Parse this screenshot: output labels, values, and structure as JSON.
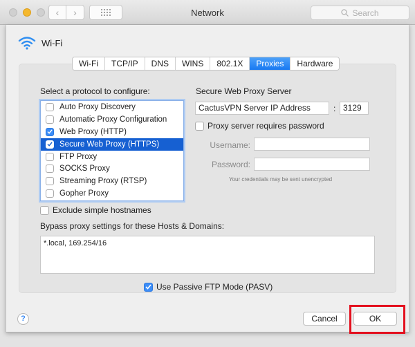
{
  "window": {
    "title": "Network",
    "search_placeholder": "Search"
  },
  "service": {
    "name": "Wi-Fi",
    "icon": "wifi-icon"
  },
  "tabs": [
    {
      "label": "Wi-Fi",
      "active": false
    },
    {
      "label": "TCP/IP",
      "active": false
    },
    {
      "label": "DNS",
      "active": false
    },
    {
      "label": "WINS",
      "active": false
    },
    {
      "label": "802.1X",
      "active": false
    },
    {
      "label": "Proxies",
      "active": true
    },
    {
      "label": "Hardware",
      "active": false
    }
  ],
  "protocols": {
    "heading": "Select a protocol to configure:",
    "items": [
      {
        "label": "Auto Proxy Discovery",
        "checked": false,
        "selected": false
      },
      {
        "label": "Automatic Proxy Configuration",
        "checked": false,
        "selected": false
      },
      {
        "label": "Web Proxy (HTTP)",
        "checked": true,
        "selected": false
      },
      {
        "label": "Secure Web Proxy (HTTPS)",
        "checked": true,
        "selected": true
      },
      {
        "label": "FTP Proxy",
        "checked": false,
        "selected": false
      },
      {
        "label": "SOCKS Proxy",
        "checked": false,
        "selected": false
      },
      {
        "label": "Streaming Proxy (RTSP)",
        "checked": false,
        "selected": false
      },
      {
        "label": "Gopher Proxy",
        "checked": false,
        "selected": false
      }
    ]
  },
  "exclude_simple_hostnames": {
    "label": "Exclude simple hostnames",
    "checked": false
  },
  "server": {
    "heading": "Secure Web Proxy Server",
    "address": "CactusVPN Server IP Address",
    "separator": ":",
    "port": "3129",
    "requires_password": {
      "label": "Proxy server requires password",
      "checked": false
    },
    "username_label": "Username:",
    "username_value": "",
    "password_label": "Password:",
    "password_value": "",
    "note": "Your credentials may be sent unencrypted"
  },
  "bypass": {
    "label": "Bypass proxy settings for these Hosts & Domains:",
    "value": "*.local, 169.254/16"
  },
  "passive_ftp": {
    "label": "Use Passive FTP Mode (PASV)",
    "checked": true
  },
  "buttons": {
    "help": "?",
    "cancel": "Cancel",
    "ok": "OK"
  },
  "colors": {
    "accent": "#1879f2",
    "selection": "#1660d2",
    "highlight_box": "#e3101e"
  }
}
